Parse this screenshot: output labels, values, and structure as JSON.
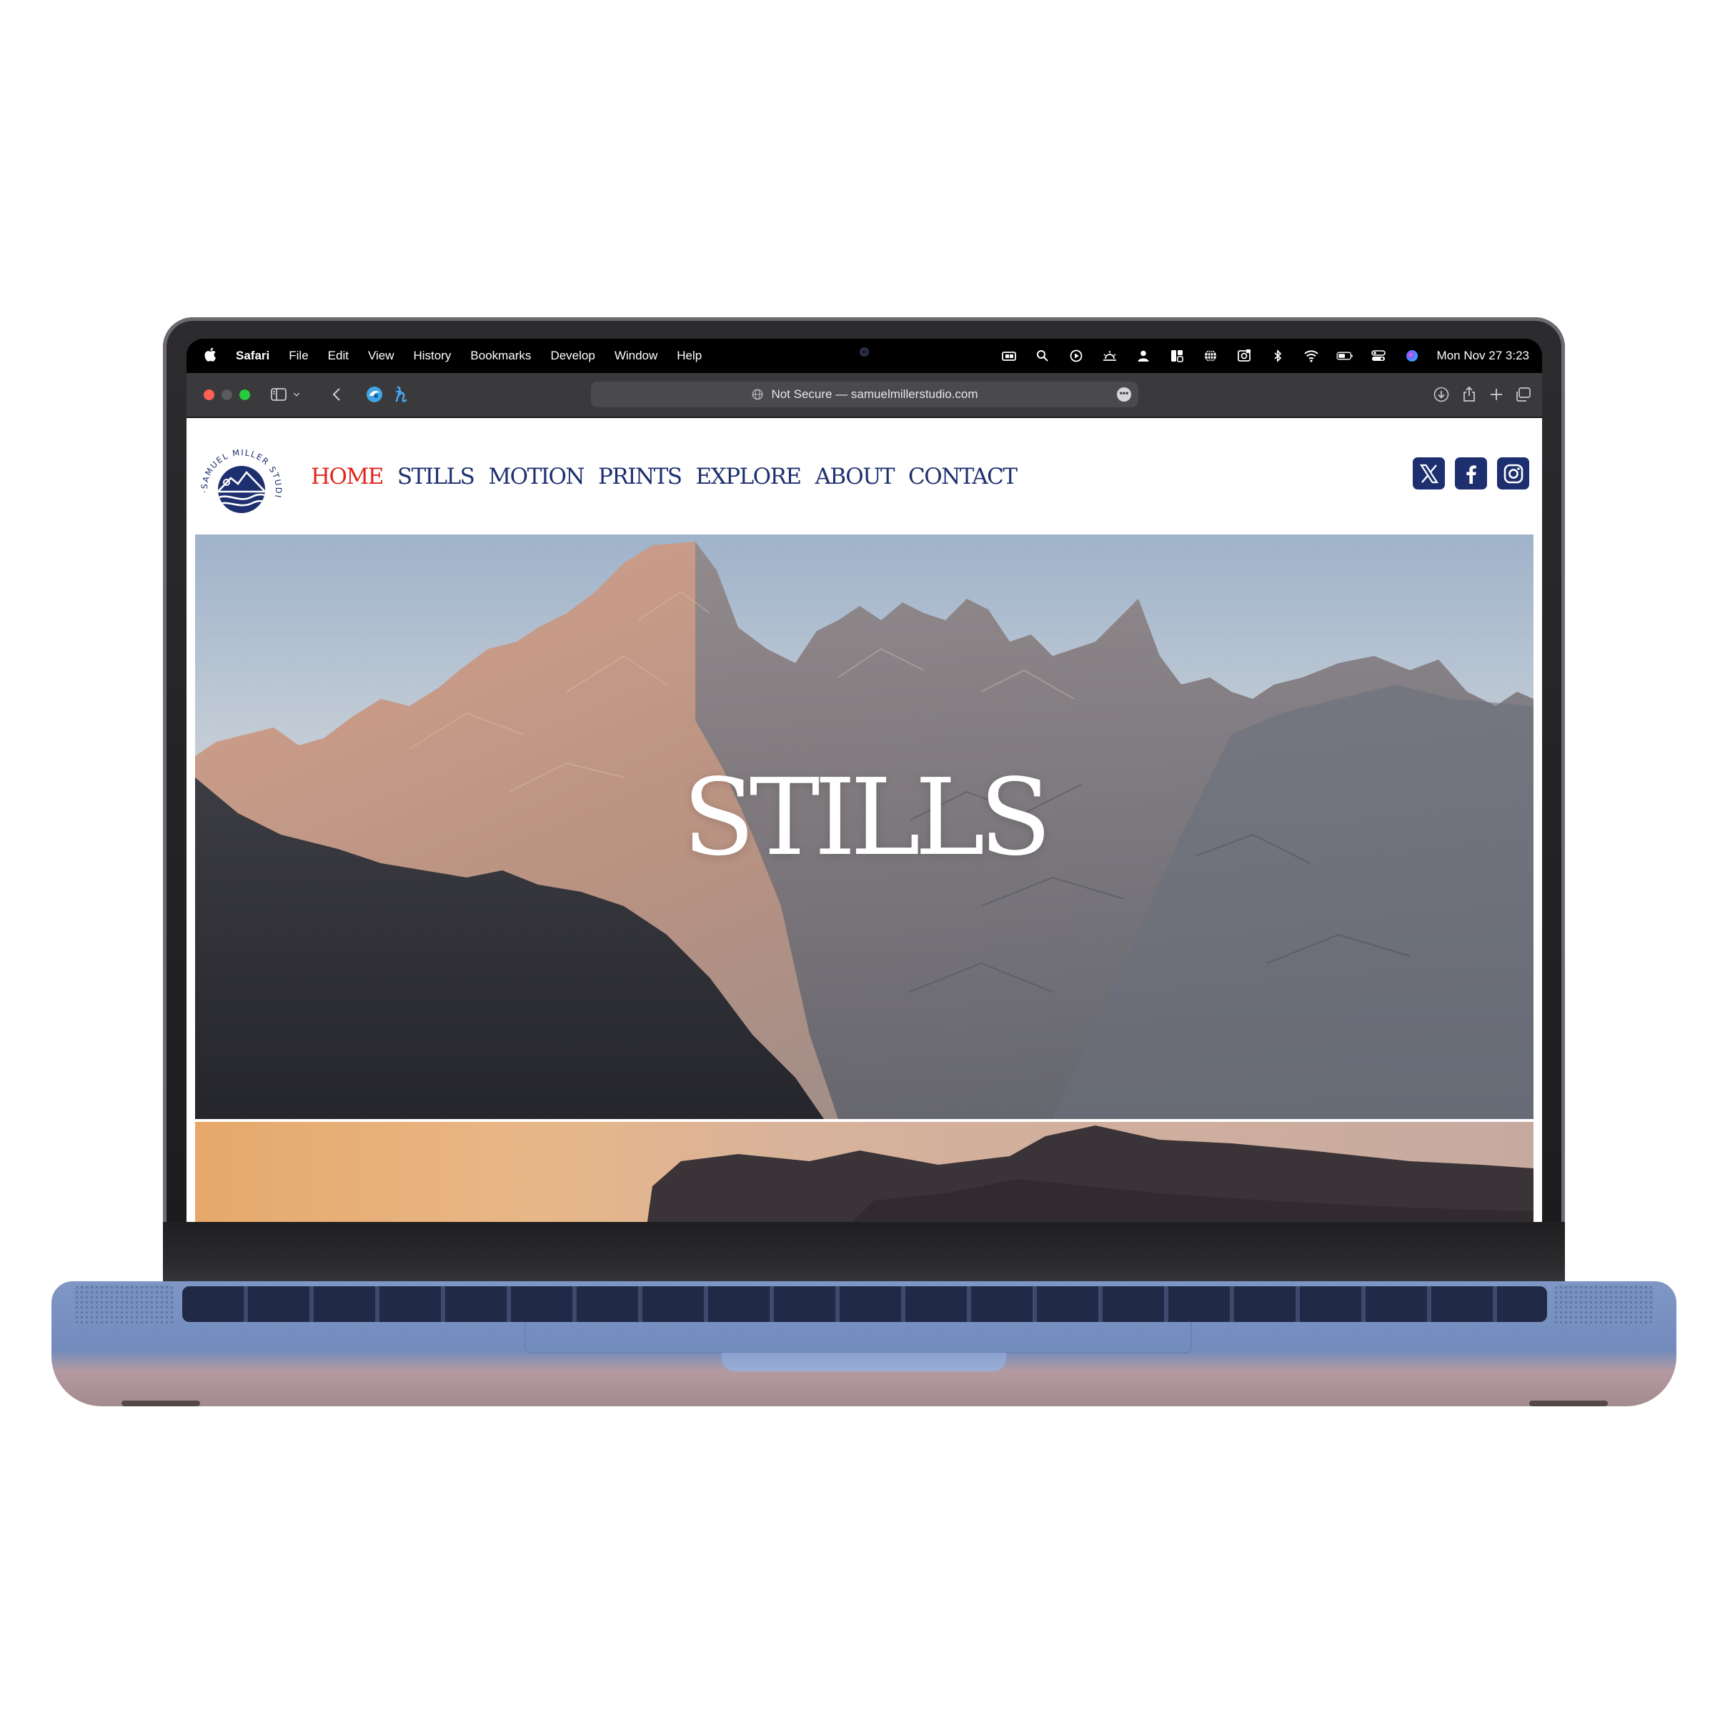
{
  "menubar": {
    "items": [
      "Safari",
      "File",
      "Edit",
      "View",
      "History",
      "Bookmarks",
      "Develop",
      "Window",
      "Help"
    ],
    "clock": "Mon Nov 27  3:23",
    "status_icons": [
      "stage-manager-icon",
      "search-icon",
      "play-icon",
      "brightness-icon",
      "user-icon",
      "grid-icon",
      "globe-icon",
      "screenshot-icon",
      "bluetooth-icon",
      "wifi-icon",
      "battery-icon",
      "control-center-icon",
      "siri-icon"
    ]
  },
  "browser": {
    "address": "Not Secure — samuelmillerstudio.com",
    "toolbar_icons": [
      "sidebar-icon",
      "chevron-down-icon",
      "back-icon",
      "extension-icon",
      "honey-icon",
      "download-icon",
      "share-icon",
      "new-tab-icon",
      "tabs-overview-icon"
    ]
  },
  "site": {
    "logo_text": "SAMUEL MILLER STUDIO",
    "nav": {
      "home": "HOME",
      "stills": "STILLS",
      "motion": "MOTION",
      "prints": "PRINTS",
      "explore": "EXPLORE",
      "about": "ABOUT",
      "contact": "CONTACT"
    },
    "social": [
      "x-icon",
      "facebook-icon",
      "instagram-icon"
    ],
    "hero_title": "STILLS",
    "colors": {
      "nav": "#1d2f6f",
      "nav_active": "#e2261c",
      "social_bg": "#1d2f6f"
    }
  }
}
